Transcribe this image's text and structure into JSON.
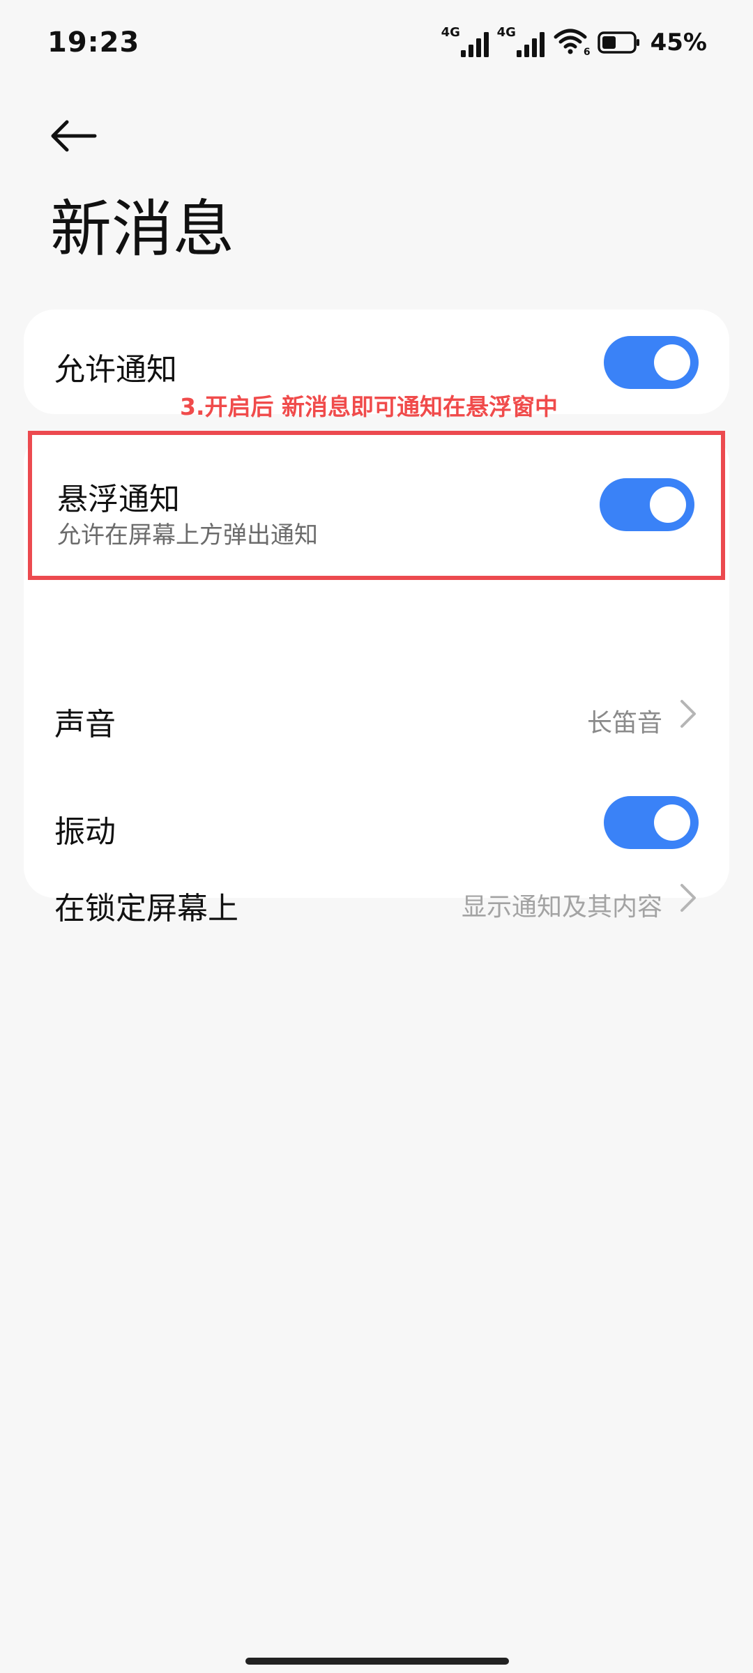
{
  "status_bar": {
    "time": "19:23",
    "signal1_tag": "4G",
    "signal2_tag": "4G",
    "wifi_tag": "6",
    "battery_percent": "45%",
    "battery_level": 0.45
  },
  "header": {
    "title": "新消息"
  },
  "settings": {
    "allow_notification": {
      "label": "允许通知",
      "enabled": true
    },
    "annotation": "3.开启后 新消息即可通知在悬浮窗中",
    "floating_notification": {
      "label": "悬浮通知",
      "subtitle": "允许在屏幕上方弹出通知",
      "enabled": true
    },
    "sound": {
      "label": "声音",
      "value": "长笛音"
    },
    "vibration": {
      "label": "振动",
      "enabled": true
    },
    "lock_screen": {
      "label": "在锁定屏幕上",
      "value": "显示通知及其内容"
    }
  },
  "colors": {
    "accent": "#3a82f7",
    "annotation": "#ec4a4f",
    "background": "#f7f7f7",
    "card": "#ffffff"
  },
  "icons": {
    "back": "arrow-left-icon",
    "chevron": "chevron-right-icon",
    "signal": "cellular-signal-icon",
    "wifi": "wifi-icon",
    "battery": "battery-icon"
  }
}
